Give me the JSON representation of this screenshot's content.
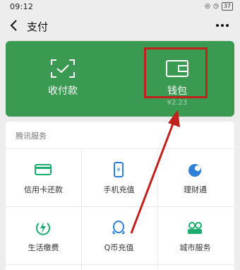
{
  "status_bar": {
    "time": "09:12",
    "signal": "·³ᴷ´∥",
    "battery": "37"
  },
  "nav": {
    "title": "支付"
  },
  "card": {
    "receive_label": "收付款",
    "wallet_label": "钱包",
    "wallet_balance": "¥2.23"
  },
  "services": {
    "header": "腾讯服务",
    "items": [
      {
        "label": "信用卡还款",
        "icon": "credit-card-icon"
      },
      {
        "label": "手机充值",
        "icon": "phone-recharge-icon"
      },
      {
        "label": "理财通",
        "icon": "wealth-icon"
      },
      {
        "label": "生活缴费",
        "icon": "utility-bill-icon"
      },
      {
        "label": "Q币充值",
        "icon": "qq-coin-icon"
      },
      {
        "label": "城市服务",
        "icon": "city-service-icon"
      }
    ]
  },
  "colors": {
    "accent_green": "#3a9a52",
    "icon_green": "#1aad6e",
    "icon_blue": "#2f7fd8",
    "annotation_red": "#c0211c"
  }
}
